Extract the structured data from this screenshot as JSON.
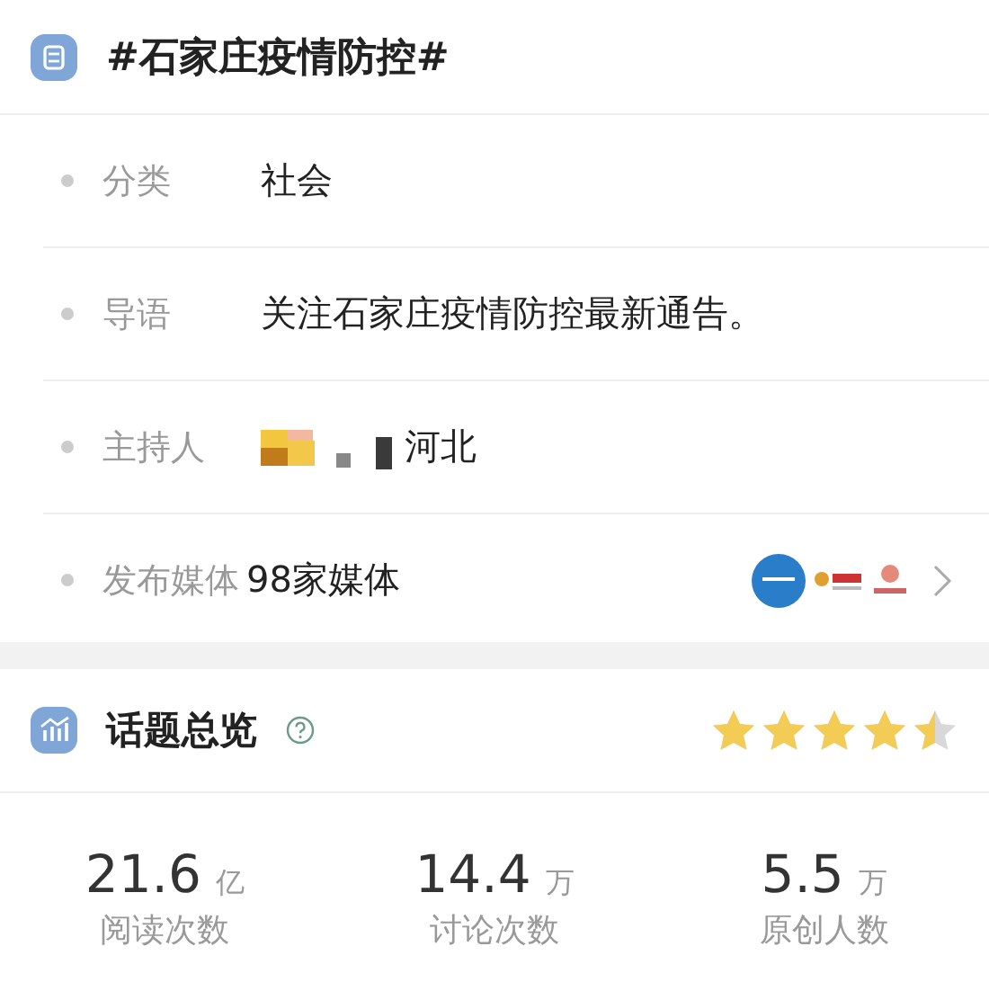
{
  "topic": {
    "title": "#石家庄疫情防控#",
    "rows": [
      {
        "kind": "text",
        "label": "分类",
        "value": "社会"
      },
      {
        "kind": "text",
        "label": "导语",
        "value": "关注石家庄疫情防控最新通告。"
      },
      {
        "kind": "host",
        "label": "主持人",
        "value": "河北"
      },
      {
        "kind": "media",
        "label": "发布媒体",
        "value": "98家媒体"
      }
    ]
  },
  "overview": {
    "title": "话题总览",
    "stars": 4.5,
    "stats": [
      {
        "number": "21.6",
        "unit": "亿",
        "label": "阅读次数"
      },
      {
        "number": "14.4",
        "unit": "万",
        "label": "讨论次数"
      },
      {
        "number": "5.5",
        "unit": "万",
        "label": "原创人数"
      }
    ]
  }
}
